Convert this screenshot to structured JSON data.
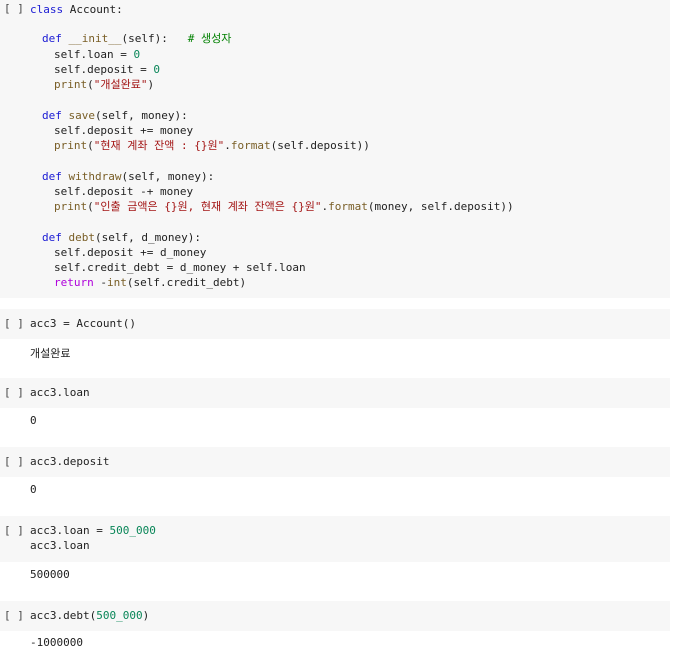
{
  "run_button": "[ ]",
  "cells": [
    {
      "lines": [
        "class Account:",
        "",
        "  def __init__(self):   # 생성자",
        "    self.loan = 0",
        "    self.deposit = 0",
        "    print(\"개설완료\")",
        "",
        "  def save(self, money):",
        "    self.deposit += money",
        "    print(\"현재 계좌 잔액 : {}원\".format(self.deposit))",
        "",
        "  def withdraw(self, money):",
        "    self.deposit -+ money",
        "    print(\"인출 금액은 {}원, 현재 계좌 잔액은 {}원\".format(money, self.deposit))",
        "",
        "  def debt(self, d_money):",
        "    self.deposit += d_money",
        "    self.credit_debt = d_money + self.loan",
        "    return -int(self.credit_debt)"
      ],
      "output": ""
    },
    {
      "lines": [
        "acc3 = Account()"
      ],
      "output": "개설완료"
    },
    {
      "lines": [
        "acc3.loan"
      ],
      "output": "0"
    },
    {
      "lines": [
        "acc3.deposit"
      ],
      "output": "0"
    },
    {
      "lines": [
        "acc3.loan = 500_000",
        "acc3.loan"
      ],
      "output": "500000"
    },
    {
      "lines": [
        "acc3.debt(500_000)"
      ],
      "output": "-1000000"
    }
  ]
}
